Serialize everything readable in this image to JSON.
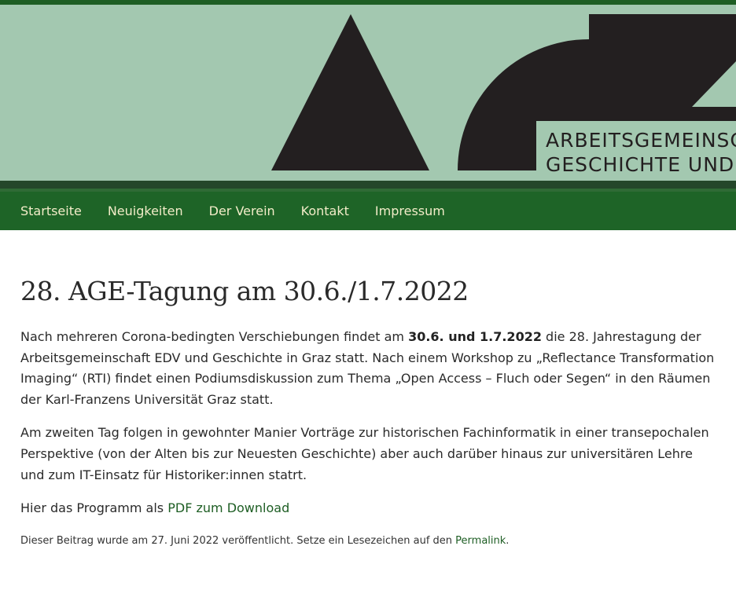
{
  "banner": {
    "line1": "ARBEITSGEMEINSC",
    "line2": "GESCHICHTE UND"
  },
  "nav": {
    "items": [
      "Startseite",
      "Neuigkeiten",
      "Der Verein",
      "Kontakt",
      "Impressum"
    ]
  },
  "post": {
    "title": "28. AGE-Tagung am 30.6./1.7.2022",
    "p1_a": "Nach mehreren Corona-bedingten Verschiebungen findet am ",
    "p1_bold": "30.6. und 1.7.2022",
    "p1_b": " die 28. Jahrestagung der Arbeitsgemeinschaft EDV und Geschichte in Graz statt. Nach einem Workshop zu „Reflectance Transformation Imaging“ (RTI) findet einen Podiumsdiskussion zum Thema „Open Access – Fluch oder Segen“ in den Räumen der Karl-Franzens Universität Graz statt.",
    "p2": "Am zweiten Tag folgen in gewohnter Manier Vorträge zur historischen Fachinformatik in einer transepochalen Perspektive (von der Alten bis zur Neuesten Geschichte) aber auch darüber hinaus zur universitären Lehre und zum IT-Einsatz für Historiker:innen statrt.",
    "p3_text": "Hier das Programm als ",
    "p3_link": "PDF zum Download",
    "meta_a": "Dieser Beitrag wurde am 27. Juni 2022 veröffentlicht. Setze ein Lesezeichen auf den ",
    "meta_link": "Permalink",
    "meta_b": "."
  },
  "colors": {
    "banner_bg": "#a3c8b0",
    "logo_dark": "#231f20",
    "nav_bg": "#1e6427",
    "nav_text": "#f2ecc8",
    "link": "#1e5e24"
  }
}
